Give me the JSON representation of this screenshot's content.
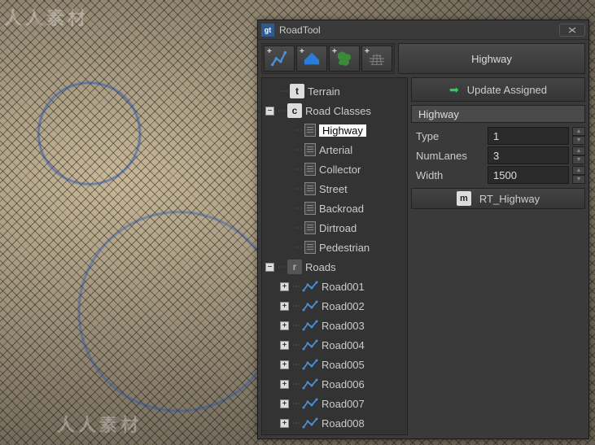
{
  "window": {
    "title": "RoadTool",
    "icon_text": "gt"
  },
  "header": {
    "selected_label": "Highway"
  },
  "toolbar": {
    "btn1": "add-road",
    "btn2": "add-terrain",
    "btn3": "add-area",
    "btn4": "add-grid"
  },
  "tree": {
    "terrain": {
      "badge": "t",
      "label": "Terrain"
    },
    "classes": {
      "badge": "c",
      "label": "Road Classes",
      "items": [
        "Highway",
        "Arterial",
        "Collector",
        "Street",
        "Backroad",
        "Dirtroad",
        "Pedestrian"
      ],
      "selected": "Highway"
    },
    "roads": {
      "badge": "r",
      "label": "Roads",
      "items": [
        "Road001",
        "Road002",
        "Road003",
        "Road004",
        "Road005",
        "Road006",
        "Road007",
        "Road008"
      ]
    }
  },
  "actions": {
    "update": "Update Assigned"
  },
  "props": {
    "section": "Highway",
    "rows": [
      {
        "label": "Type",
        "value": "1"
      },
      {
        "label": "NumLanes",
        "value": "3"
      },
      {
        "label": "Width",
        "value": "1500"
      }
    ],
    "material": {
      "icon": "m",
      "label": "RT_Highway"
    }
  },
  "watermark": "人人素材"
}
